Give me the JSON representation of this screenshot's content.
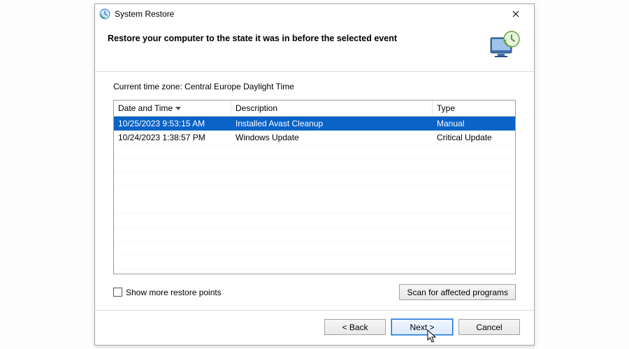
{
  "window": {
    "title": "System Restore"
  },
  "header": {
    "heading": "Restore your computer to the state it was in before the selected event"
  },
  "timezone": {
    "label": "Current time zone: Central Europe Daylight Time"
  },
  "grid": {
    "columns": {
      "date": "Date and Time",
      "desc": "Description",
      "type": "Type"
    },
    "rows": [
      {
        "date": "10/25/2023 9:53:15 AM",
        "desc": "Installed Avast Cleanup",
        "type": "Manual",
        "selected": true
      },
      {
        "date": "10/24/2023 1:38:57 PM",
        "desc": "Windows Update",
        "type": "Critical Update",
        "selected": false
      }
    ]
  },
  "options": {
    "show_more_label": "Show more restore points",
    "scan_label": "Scan for affected programs"
  },
  "footer": {
    "back": "< Back",
    "next": "Next >",
    "cancel": "Cancel"
  }
}
